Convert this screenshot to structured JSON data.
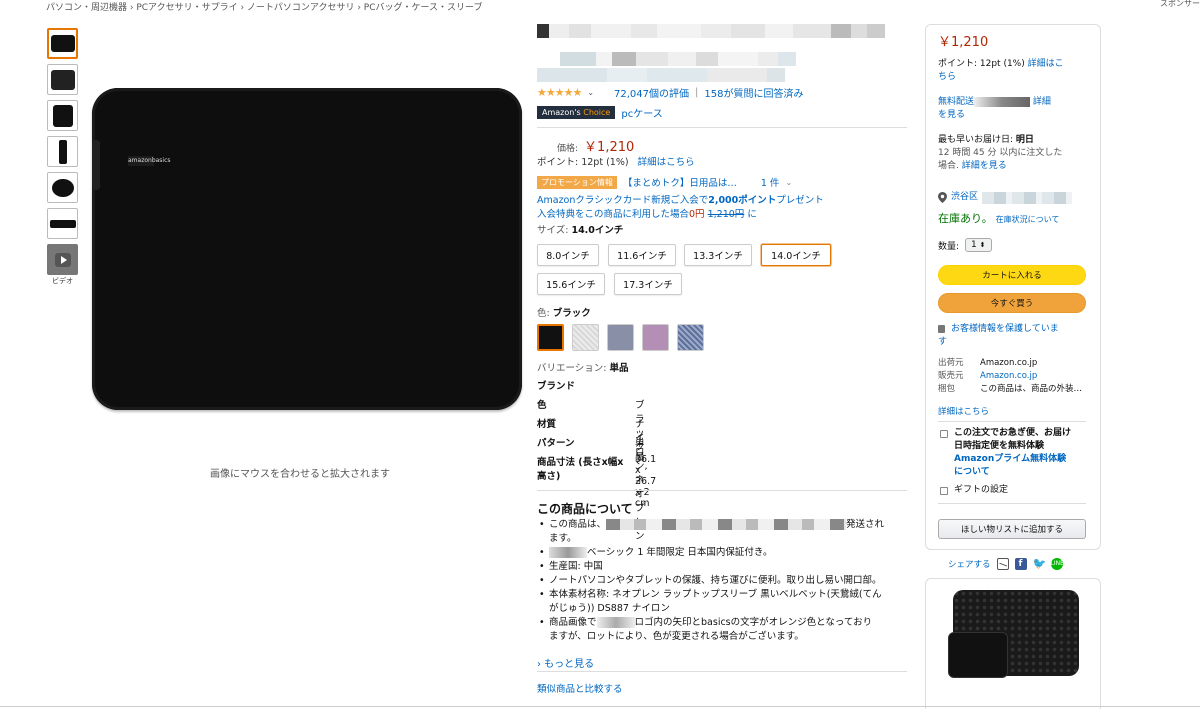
{
  "breadcrumb": "パソコン・周辺機器 › PCアクセサリ・サプライ › ノートパソコンアクセサリ › PCバッグ・ケース・スリーブ",
  "sponsor": "スポンサー",
  "gallery": {
    "video_label": "ビデオ",
    "zoom_hint": "画像にマウスを合わせると拡大されます",
    "brand_on_product": "amazonbasics"
  },
  "rating": {
    "stars": "★★★★★",
    "count": "72,047個の評価",
    "divider": "|",
    "answered": "158が質問に回答済み"
  },
  "choice": {
    "badge_prefix": "Amazon's",
    "badge_suffix": "Choice",
    "category": "pcケース"
  },
  "price": {
    "label": "価格:",
    "value": "￥1,210",
    "points": "ポイント: 12pt  (1%)",
    "points_link": "詳細はこちら"
  },
  "promo": {
    "badge": "プロモーション情報",
    "text": "【まとめトク】日用品は…",
    "count": "1 件"
  },
  "card": {
    "line1_a": "Amazonクラシックカード新規ご入会で",
    "line1_b": "2,000ポイント",
    "line1_c": "プレゼント",
    "line2_a": "入会特典をこの商品に利用した場合",
    "line2_b": "0円",
    "line2_c": "1,210円",
    "line2_d": "に"
  },
  "size": {
    "label": "サイズ:",
    "selected": "14.0インチ",
    "options": [
      "8.0インチ",
      "11.6インチ",
      "13.3インチ",
      "14.0インチ",
      "15.6インチ",
      "17.3インチ"
    ]
  },
  "color": {
    "label": "色:",
    "selected": "ブラック",
    "swatches": [
      "#111111",
      "#e6e6e6",
      "#8a8fa8",
      "#b48fb5",
      "#5d6f9a"
    ]
  },
  "variation": {
    "label": "バリエーション:",
    "value": "単品"
  },
  "specs": [
    {
      "k": "ブランド",
      "v": ""
    },
    {
      "k": "色",
      "v": "ブラック"
    },
    {
      "k": "材質",
      "v": "ナイロン, ネオプレン"
    },
    {
      "k": "パターン",
      "v": "単品"
    },
    {
      "k": "商品寸法 (長さx幅x",
      "v": "36.1 x 26.7 x 2 cm"
    },
    {
      "k": "高さ)",
      "v": ""
    }
  ],
  "about": {
    "title": "この商品について",
    "b1_a": "この商品は、",
    "b1_b": "発送され",
    "b1_c": "ます。",
    "b2": "ベーシック 1 年間限定 日本国内保証付き。",
    "b3": "生産国: 中国",
    "b4": "ノートパソコンやタブレットの保護、持ち運びに便利。取り出し易い開口部。",
    "b5_a": "本体素材名称: ネオプレン ラップトップスリーブ 黒いベルベット(天鵞絨(てん",
    "b5_b": "がじゅう)) DS887 ナイロン",
    "b6_a": "商品画像で",
    "b6_b": "ロゴ内の矢印とbasicsの文字がオレンジ色となっており",
    "b6_c": "ますが、ロットにより、色が変更される場合がございます。",
    "more": "› もっと見る",
    "compare": "類似商品と比較する"
  },
  "buybox": {
    "price": "￥1,210",
    "points": "ポイント: 12pt  (1%)",
    "points_link": "詳細はこ",
    "points_link2": "ちら",
    "shipping": "無料配送",
    "detail": "詳細",
    "detail2": "を見る",
    "earliest_label": "最も早いお届け日:",
    "earliest_value": "明日",
    "order_within": "12 時間 45 分 以内に注文した",
    "case_text": "場合.",
    "case_link": "詳細を見る",
    "location": "渋谷区",
    "stock": "在庫あり。",
    "stock_link": "在庫状況について",
    "qty_label": "数量:",
    "qty_value": "1",
    "add_to_cart": "カートに入れる",
    "buy_now": "今すぐ買う",
    "secure": "お客様情報を保護していま",
    "secure2": "す",
    "ship_from_label": "出荷元",
    "ship_from": "Amazon.co.jp",
    "seller_label": "販売元",
    "seller": "Amazon.co.jp",
    "pack_label": "梱包",
    "pack": "この商品は、商品の外装…",
    "details_link": "詳細はこちら",
    "prime_a": "この注文でお急ぎ便、お届け",
    "prime_b": "日時指定便を無料体験",
    "prime_c": "Amazonプライム無料体験",
    "prime_d": "について",
    "gift": "ギフトの設定",
    "wishlist": "ほしい物リストに追加する"
  },
  "share": {
    "label": "シェアする"
  }
}
